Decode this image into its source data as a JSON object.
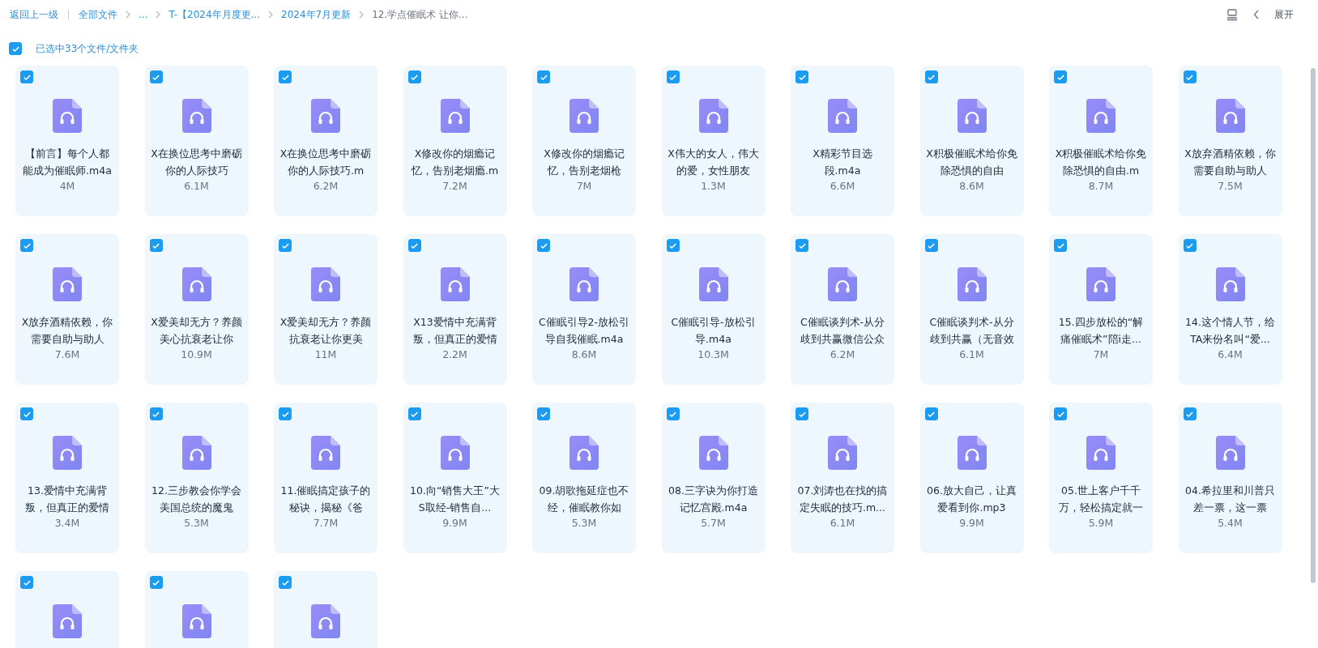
{
  "breadcrumb": {
    "back": "返回上一级",
    "items": [
      {
        "label": "全部文件",
        "current": false
      },
      {
        "label": "...",
        "current": false
      },
      {
        "label": "T-【2024年月度更...",
        "current": false
      },
      {
        "label": "2024年7月更新",
        "current": false
      },
      {
        "label": "12.学点催眠术 让你...",
        "current": true
      }
    ]
  },
  "toolbar": {
    "expand": "展开"
  },
  "select_all": {
    "checked": true,
    "label": "已选中33个文件/文件夹"
  },
  "files": [
    {
      "name": "【前言】每个人都能成为催眠师.m4a",
      "size": "4M",
      "selected": true
    },
    {
      "name": "X在换位思考中磨砺你的人际技巧",
      "size": "6.1M",
      "selected": true
    },
    {
      "name": "X在换位思考中磨砺你的人际技巧.m",
      "size": "6.2M",
      "selected": true
    },
    {
      "name": "X修改你的烟瘾记忆，告别老烟瘾.m",
      "size": "7.2M",
      "selected": true
    },
    {
      "name": "X修改你的烟瘾记忆，告别老烟枪",
      "size": "7M",
      "selected": true
    },
    {
      "name": "X伟大的女人，伟大的爱，女性朋友",
      "size": "1.3M",
      "selected": true
    },
    {
      "name": "X精彩节目选段.m4a",
      "size": "6.6M",
      "selected": true
    },
    {
      "name": "X积极催眠术给你免除恐惧的自由",
      "size": "8.6M",
      "selected": true
    },
    {
      "name": "X积极催眠术给你免除恐惧的自由.m",
      "size": "8.7M",
      "selected": true
    },
    {
      "name": "X放弃酒精依赖，你需要自助与助人",
      "size": "7.5M",
      "selected": true
    },
    {
      "name": "X放弃酒精依赖，你需要自助与助人",
      "size": "7.6M",
      "selected": true
    },
    {
      "name": "X爱美却无方？养颜美心抗衰老让你",
      "size": "10.9M",
      "selected": true
    },
    {
      "name": "X爱美却无方？养颜抗衰老让你更美",
      "size": "11M",
      "selected": true
    },
    {
      "name": "X13爱情中充满背叛，但真正的爱情",
      "size": "2.2M",
      "selected": true
    },
    {
      "name": "C催眠引导2-放松引导自我催眠.m4a",
      "size": "8.6M",
      "selected": true
    },
    {
      "name": "C催眠引导-放松引导.m4a",
      "size": "10.3M",
      "selected": true
    },
    {
      "name": "C催眠谈判术-从分歧到共赢微信公众",
      "size": "6.2M",
      "selected": true
    },
    {
      "name": "C催眠谈判术-从分歧到共赢（无音效",
      "size": "6.1M",
      "selected": true
    },
    {
      "name": "15.四步放松的“解痛催眠术”陪i走...",
      "size": "7M",
      "selected": true
    },
    {
      "name": "14.这个情人节，给TA来份名叫“爱...",
      "size": "6.4M",
      "selected": true
    },
    {
      "name": "13.爱情中充满背叛，但真正的爱情",
      "size": "3.4M",
      "selected": true
    },
    {
      "name": "12.三步教会你学会美国总统的魔鬼",
      "size": "5.3M",
      "selected": true
    },
    {
      "name": "11.催眠搞定孩子的秘诀，揭秘《爸",
      "size": "7.7M",
      "selected": true
    },
    {
      "name": "10.向“销售大王”大S取经-销售自...",
      "size": "9.9M",
      "selected": true
    },
    {
      "name": "09.胡歌拖延症也不经，催眠教你如",
      "size": "5.3M",
      "selected": true
    },
    {
      "name": "08.三字诀为你打造记忆宫殿.m4a",
      "size": "5.7M",
      "selected": true
    },
    {
      "name": "07.刘涛也在找的搞定失眠的技巧.m...",
      "size": "6.1M",
      "selected": true
    },
    {
      "name": "06.放大自己，让真爱看到你.mp3",
      "size": "9.9M",
      "selected": true
    },
    {
      "name": "05.世上客户千千万，轻松搞定就一",
      "size": "5.9M",
      "selected": true
    },
    {
      "name": "04.希拉里和川普只差一票，这一票",
      "size": "5.4M",
      "selected": true
    },
    {
      "selected": true
    },
    {
      "selected": true
    },
    {
      "selected": true
    }
  ]
}
